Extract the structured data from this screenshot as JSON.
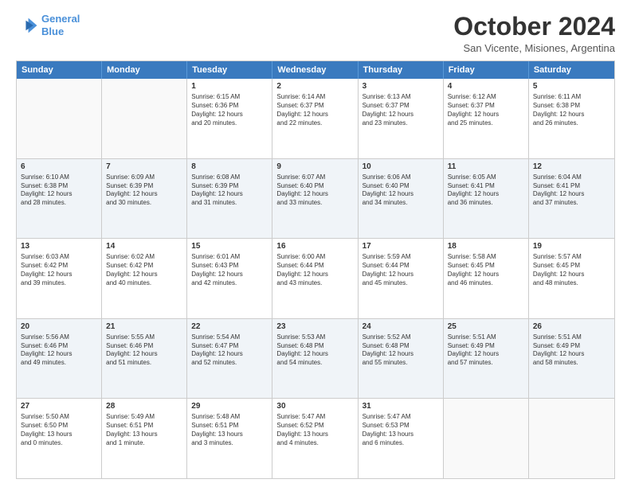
{
  "header": {
    "logo_line1": "General",
    "logo_line2": "Blue",
    "month_title": "October 2024",
    "location": "San Vicente, Misiones, Argentina"
  },
  "days_of_week": [
    "Sunday",
    "Monday",
    "Tuesday",
    "Wednesday",
    "Thursday",
    "Friday",
    "Saturday"
  ],
  "rows": [
    {
      "cells": [
        {
          "day": "",
          "text": "",
          "empty": true
        },
        {
          "day": "",
          "text": "",
          "empty": true
        },
        {
          "day": "1",
          "text": "Sunrise: 6:15 AM\nSunset: 6:36 PM\nDaylight: 12 hours\nand 20 minutes."
        },
        {
          "day": "2",
          "text": "Sunrise: 6:14 AM\nSunset: 6:37 PM\nDaylight: 12 hours\nand 22 minutes."
        },
        {
          "day": "3",
          "text": "Sunrise: 6:13 AM\nSunset: 6:37 PM\nDaylight: 12 hours\nand 23 minutes."
        },
        {
          "day": "4",
          "text": "Sunrise: 6:12 AM\nSunset: 6:37 PM\nDaylight: 12 hours\nand 25 minutes."
        },
        {
          "day": "5",
          "text": "Sunrise: 6:11 AM\nSunset: 6:38 PM\nDaylight: 12 hours\nand 26 minutes."
        }
      ]
    },
    {
      "cells": [
        {
          "day": "6",
          "text": "Sunrise: 6:10 AM\nSunset: 6:38 PM\nDaylight: 12 hours\nand 28 minutes."
        },
        {
          "day": "7",
          "text": "Sunrise: 6:09 AM\nSunset: 6:39 PM\nDaylight: 12 hours\nand 30 minutes."
        },
        {
          "day": "8",
          "text": "Sunrise: 6:08 AM\nSunset: 6:39 PM\nDaylight: 12 hours\nand 31 minutes."
        },
        {
          "day": "9",
          "text": "Sunrise: 6:07 AM\nSunset: 6:40 PM\nDaylight: 12 hours\nand 33 minutes."
        },
        {
          "day": "10",
          "text": "Sunrise: 6:06 AM\nSunset: 6:40 PM\nDaylight: 12 hours\nand 34 minutes."
        },
        {
          "day": "11",
          "text": "Sunrise: 6:05 AM\nSunset: 6:41 PM\nDaylight: 12 hours\nand 36 minutes."
        },
        {
          "day": "12",
          "text": "Sunrise: 6:04 AM\nSunset: 6:41 PM\nDaylight: 12 hours\nand 37 minutes."
        }
      ]
    },
    {
      "cells": [
        {
          "day": "13",
          "text": "Sunrise: 6:03 AM\nSunset: 6:42 PM\nDaylight: 12 hours\nand 39 minutes."
        },
        {
          "day": "14",
          "text": "Sunrise: 6:02 AM\nSunset: 6:42 PM\nDaylight: 12 hours\nand 40 minutes."
        },
        {
          "day": "15",
          "text": "Sunrise: 6:01 AM\nSunset: 6:43 PM\nDaylight: 12 hours\nand 42 minutes."
        },
        {
          "day": "16",
          "text": "Sunrise: 6:00 AM\nSunset: 6:44 PM\nDaylight: 12 hours\nand 43 minutes."
        },
        {
          "day": "17",
          "text": "Sunrise: 5:59 AM\nSunset: 6:44 PM\nDaylight: 12 hours\nand 45 minutes."
        },
        {
          "day": "18",
          "text": "Sunrise: 5:58 AM\nSunset: 6:45 PM\nDaylight: 12 hours\nand 46 minutes."
        },
        {
          "day": "19",
          "text": "Sunrise: 5:57 AM\nSunset: 6:45 PM\nDaylight: 12 hours\nand 48 minutes."
        }
      ]
    },
    {
      "cells": [
        {
          "day": "20",
          "text": "Sunrise: 5:56 AM\nSunset: 6:46 PM\nDaylight: 12 hours\nand 49 minutes."
        },
        {
          "day": "21",
          "text": "Sunrise: 5:55 AM\nSunset: 6:46 PM\nDaylight: 12 hours\nand 51 minutes."
        },
        {
          "day": "22",
          "text": "Sunrise: 5:54 AM\nSunset: 6:47 PM\nDaylight: 12 hours\nand 52 minutes."
        },
        {
          "day": "23",
          "text": "Sunrise: 5:53 AM\nSunset: 6:48 PM\nDaylight: 12 hours\nand 54 minutes."
        },
        {
          "day": "24",
          "text": "Sunrise: 5:52 AM\nSunset: 6:48 PM\nDaylight: 12 hours\nand 55 minutes."
        },
        {
          "day": "25",
          "text": "Sunrise: 5:51 AM\nSunset: 6:49 PM\nDaylight: 12 hours\nand 57 minutes."
        },
        {
          "day": "26",
          "text": "Sunrise: 5:51 AM\nSunset: 6:49 PM\nDaylight: 12 hours\nand 58 minutes."
        }
      ]
    },
    {
      "cells": [
        {
          "day": "27",
          "text": "Sunrise: 5:50 AM\nSunset: 6:50 PM\nDaylight: 13 hours\nand 0 minutes."
        },
        {
          "day": "28",
          "text": "Sunrise: 5:49 AM\nSunset: 6:51 PM\nDaylight: 13 hours\nand 1 minute."
        },
        {
          "day": "29",
          "text": "Sunrise: 5:48 AM\nSunset: 6:51 PM\nDaylight: 13 hours\nand 3 minutes."
        },
        {
          "day": "30",
          "text": "Sunrise: 5:47 AM\nSunset: 6:52 PM\nDaylight: 13 hours\nand 4 minutes."
        },
        {
          "day": "31",
          "text": "Sunrise: 5:47 AM\nSunset: 6:53 PM\nDaylight: 13 hours\nand 6 minutes."
        },
        {
          "day": "",
          "text": "",
          "empty": true
        },
        {
          "day": "",
          "text": "",
          "empty": true
        }
      ]
    }
  ]
}
